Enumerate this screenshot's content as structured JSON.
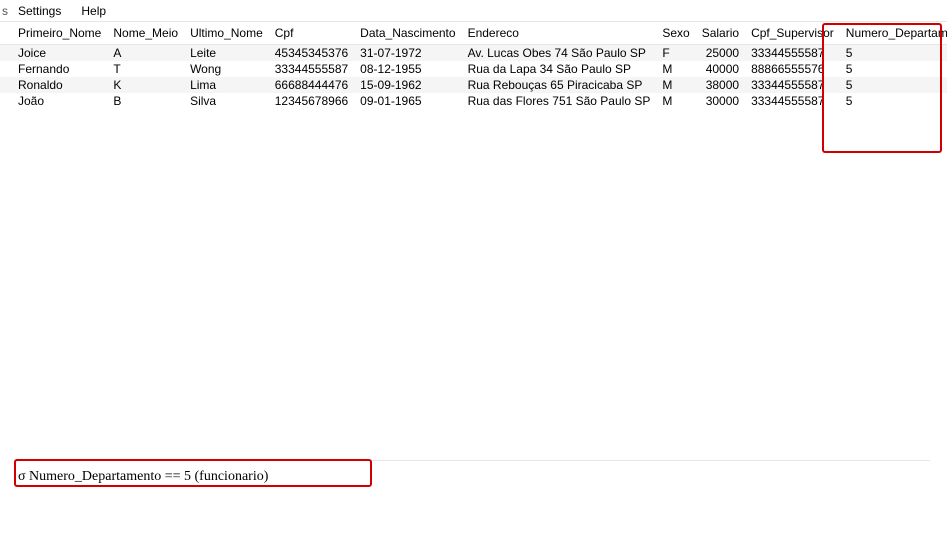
{
  "menubar": {
    "stub": "s",
    "items": [
      "Settings",
      "Help"
    ]
  },
  "table": {
    "columns": [
      "Primeiro_Nome",
      "Nome_Meio",
      "Ultimo_Nome",
      "Cpf",
      "Data_Nascimento",
      "Endereco",
      "Sexo",
      "Salario",
      "Cpf_Supervisor",
      "Numero_Departamento"
    ],
    "rows": [
      {
        "primeiro_nome": "Joice",
        "nome_meio": "A",
        "ultimo_nome": "Leite",
        "cpf": "45345345376",
        "data_nascimento": "31-07-1972",
        "endereco": "Av. Lucas Obes 74 São Paulo SP",
        "sexo": "F",
        "salario": "25000",
        "cpf_supervisor": "33344555587",
        "numero_departamento": "5"
      },
      {
        "primeiro_nome": "Fernando",
        "nome_meio": "T",
        "ultimo_nome": "Wong",
        "cpf": "33344555587",
        "data_nascimento": "08-12-1955",
        "endereco": "Rua da Lapa 34 São Paulo SP",
        "sexo": "M",
        "salario": "40000",
        "cpf_supervisor": "88866555576",
        "numero_departamento": "5"
      },
      {
        "primeiro_nome": "Ronaldo",
        "nome_meio": "K",
        "ultimo_nome": "Lima",
        "cpf": "66688444476",
        "data_nascimento": "15-09-1962",
        "endereco": "Rua Rebouças 65 Piracicaba SP",
        "sexo": "M",
        "salario": "38000",
        "cpf_supervisor": "33344555587",
        "numero_departamento": "5"
      },
      {
        "primeiro_nome": "João",
        "nome_meio": "B",
        "ultimo_nome": "Silva",
        "cpf": "12345678966",
        "data_nascimento": "09-01-1965",
        "endereco": "Rua das Flores 751 São Paulo SP",
        "sexo": "M",
        "salario": "30000",
        "cpf_supervisor": "33344555587",
        "numero_departamento": "5"
      }
    ]
  },
  "query": {
    "value": "σ Numero_Departamento == 5 (funcionario)"
  }
}
